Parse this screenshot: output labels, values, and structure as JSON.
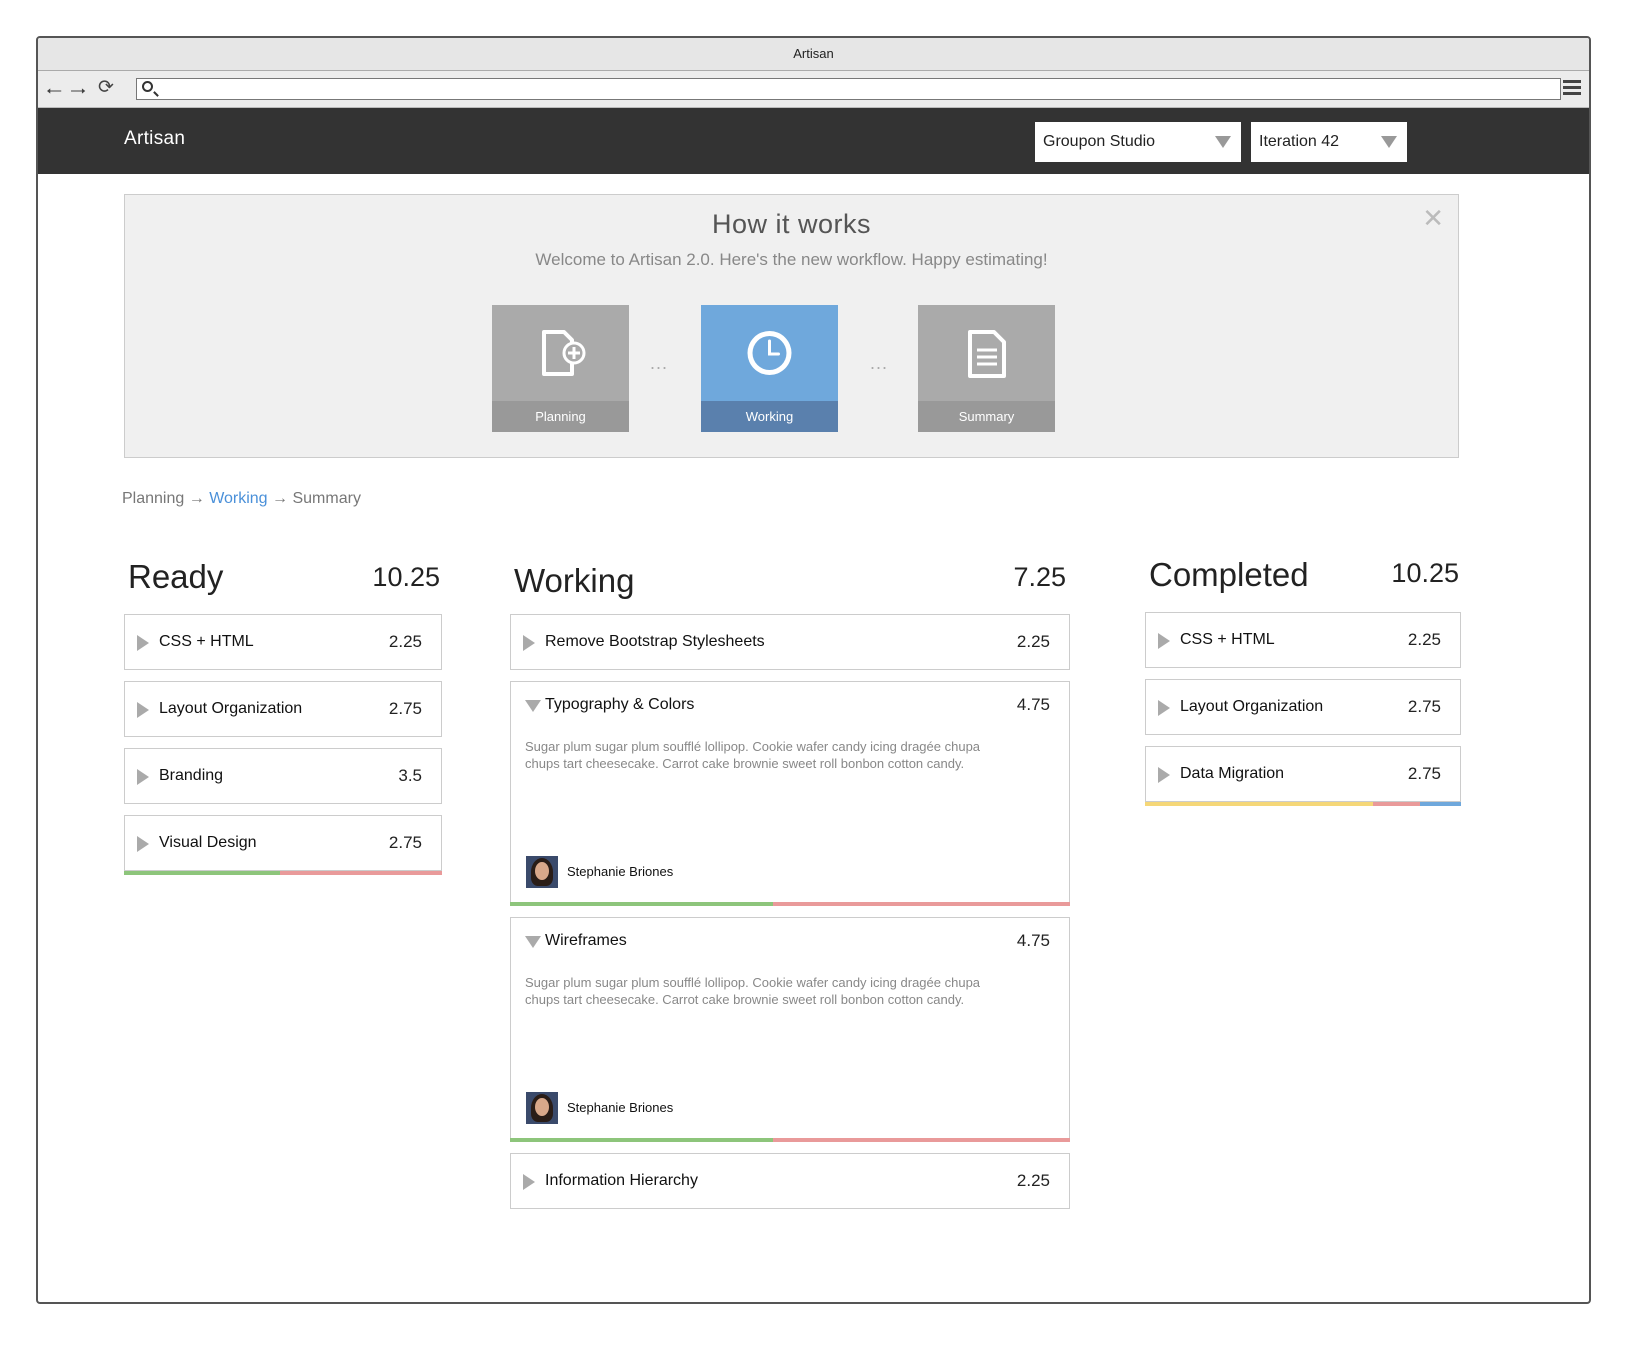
{
  "window": {
    "title": "Artisan"
  },
  "browser": {
    "url_value": "",
    "icons": [
      "back-arrow-icon",
      "forward-arrow-icon",
      "refresh-icon",
      "search-icon",
      "menu-icon"
    ]
  },
  "app": {
    "brand": "Artisan",
    "team_select": "Groupon Studio",
    "iteration_select": "Iteration 42"
  },
  "how_it_works": {
    "title": "How it works",
    "subtitle": "Welcome to Artisan 2.0. Here's the new workflow. Happy estimating!",
    "close_icon": "close-icon",
    "separator": "...",
    "steps": [
      {
        "label": "Planning",
        "icon": "new-document-icon",
        "active": false
      },
      {
        "label": "Working",
        "icon": "clock-icon",
        "active": true
      },
      {
        "label": "Summary",
        "icon": "document-list-icon",
        "active": false
      }
    ]
  },
  "breadcrumb": {
    "planning": "Planning",
    "arrow": "→",
    "working": "Working",
    "summary": "Summary"
  },
  "colors": {
    "green": "#8dc57b",
    "red": "#e99a9a",
    "yellow": "#f5d778",
    "blue": "#6fa8dc",
    "appbar": "#333333"
  },
  "columns": {
    "ready": {
      "title": "Ready",
      "total": "10.25",
      "cards": [
        {
          "name": "CSS + HTML",
          "points": "2.25"
        },
        {
          "name": "Layout Organization",
          "points": "2.75"
        },
        {
          "name": "Branding",
          "points": "3.5"
        },
        {
          "name": "Visual Design",
          "points": "2.75"
        }
      ],
      "progress": [
        {
          "color": "#8dc57b",
          "fraction": 0.49
        },
        {
          "color": "#e99a9a",
          "fraction": 0.51
        }
      ]
    },
    "working": {
      "title": "Working",
      "total": "7.25",
      "cards": [
        {
          "name": "Remove Bootstrap Stylesheets",
          "points": "2.25"
        },
        {
          "name": "Typography & Colors",
          "points": "4.75",
          "description": "Sugar plum sugar plum soufflé lollipop. Cookie wafer candy icing dragée chupa chups tart cheesecake. Carrot cake brownie sweet roll bonbon cotton candy.",
          "assignee": "Stephanie Briones",
          "progress": [
            {
              "color": "#8dc57b",
              "fraction": 0.47
            },
            {
              "color": "#e99a9a",
              "fraction": 0.53
            }
          ]
        },
        {
          "name": "Wireframes",
          "points": "4.75",
          "description": "Sugar plum sugar plum soufflé lollipop. Cookie wafer candy icing dragée chupa chups tart cheesecake. Carrot cake brownie sweet roll bonbon cotton candy.",
          "assignee": "Stephanie Briones",
          "progress": [
            {
              "color": "#8dc57b",
              "fraction": 0.47
            },
            {
              "color": "#e99a9a",
              "fraction": 0.53
            }
          ]
        },
        {
          "name": "Information Hierarchy",
          "points": "2.25"
        }
      ]
    },
    "completed": {
      "title": "Completed",
      "total": "10.25",
      "cards": [
        {
          "name": "CSS + HTML",
          "points": "2.25"
        },
        {
          "name": "Layout Organization",
          "points": "2.75"
        },
        {
          "name": "Data Migration",
          "points": "2.75"
        }
      ],
      "progress": [
        {
          "color": "#f5d778",
          "fraction": 0.72
        },
        {
          "color": "#e99a9a",
          "fraction": 0.15
        },
        {
          "color": "#6fa8dc",
          "fraction": 0.13
        }
      ]
    }
  }
}
